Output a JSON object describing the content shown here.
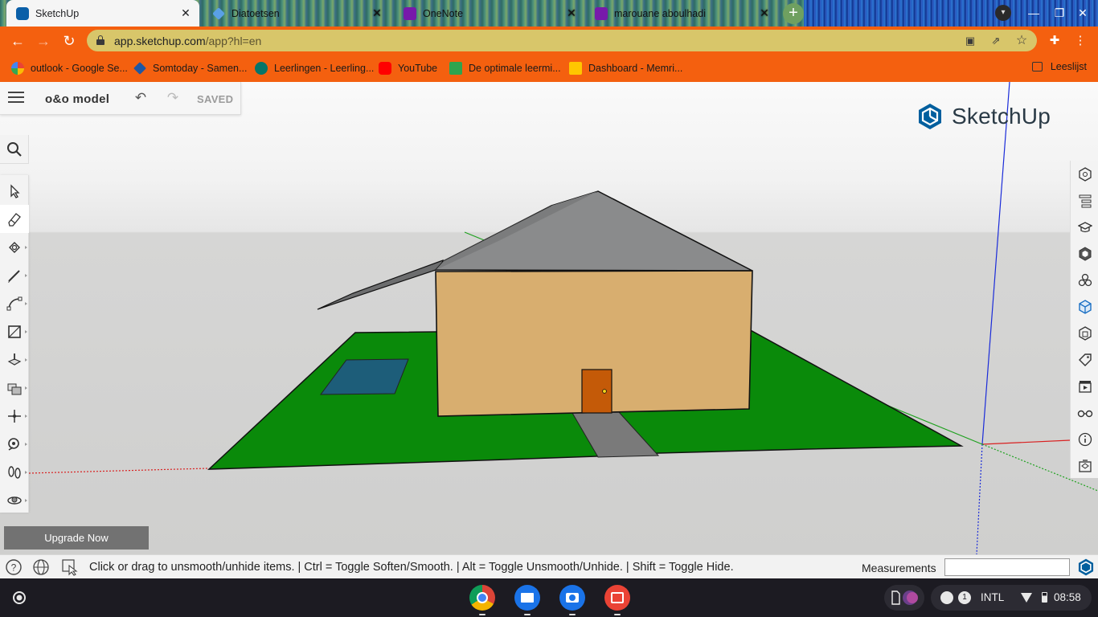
{
  "browser": {
    "tabs": [
      {
        "title": "SketchUp",
        "active": true,
        "favicon": "sketchup-icon"
      },
      {
        "title": "Diatoetsen",
        "active": false,
        "favicon": "diamond-icon"
      },
      {
        "title": "OneNote",
        "active": false,
        "favicon": "onenote-icon"
      },
      {
        "title": "marouane aboulhadi",
        "active": false,
        "favicon": "onenote-icon"
      }
    ],
    "close_glyph": "✕",
    "new_tab_glyph": "+",
    "url_host": "app.sketchup.com",
    "url_path": "/app?hl=en",
    "bookmarks": [
      {
        "label": "outlook - Google Se...",
        "icon": "google-icon"
      },
      {
        "label": "Somtoday - Samen...",
        "icon": "somtoday-icon"
      },
      {
        "label": "Leerlingen - Leerling...",
        "icon": "sharepoint-icon"
      },
      {
        "label": "YouTube",
        "icon": "youtube-icon"
      },
      {
        "label": "De optimale leermi...",
        "icon": "document-icon"
      },
      {
        "label": "Dashboard - Memri...",
        "icon": "memrise-icon"
      }
    ],
    "reading_list": "Leeslijst",
    "colors": {
      "toolbar": "#f4600f",
      "omnibox": "#d8c66a"
    }
  },
  "sketchup": {
    "model_name": "o&o model",
    "save_status": "SAVED",
    "logo_text": "SketchUp",
    "upgrade_label": "Upgrade Now",
    "status_text": "Click or drag to unsmooth/unhide items. | Ctrl = Toggle Soften/Smooth. | Alt = Toggle Unsmooth/Unhide. | Shift = Toggle Hide.",
    "measurements_label": "Measurements",
    "measurements_value": "",
    "tools": [
      "select-tool",
      "eraser-tool",
      "paint-bucket-tool",
      "pencil-tool",
      "arc-tool",
      "rectangle-tool",
      "push-pull-tool",
      "offset-tool",
      "move-tool",
      "tape-measure-tool",
      "walk-tool",
      "orbit-tool"
    ],
    "selected_tool": "eraser-tool",
    "right_panel": [
      "entity-info-icon",
      "outliner-icon",
      "instructor-icon",
      "materials-icon",
      "components-icon",
      "styles-icon",
      "layers-icon",
      "tags-icon",
      "scenes-icon",
      "display-icon",
      "info-icon",
      "export-icon"
    ],
    "colors": {
      "grass": "#0a8a0a",
      "wall": "#d8ae6f",
      "roof": "#8a8b8c",
      "door": "#c45a08",
      "pool": "#1d5d79",
      "path": "#7a7a7a"
    }
  },
  "shelf": {
    "apps": [
      "chrome-icon",
      "files-icon",
      "camera-icon",
      "gallery-icon"
    ],
    "notification_count": "1",
    "input_method": "INTL",
    "time": "08:58"
  }
}
